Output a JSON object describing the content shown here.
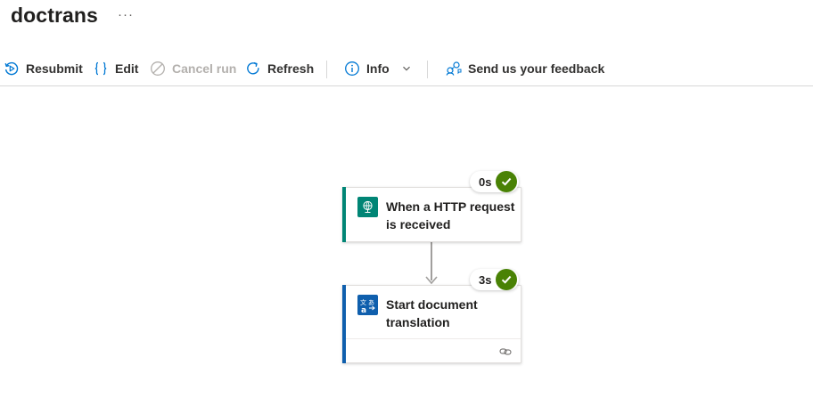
{
  "app": {
    "title": "doctrans",
    "more": "···"
  },
  "toolbar": {
    "resubmit": "Resubmit",
    "edit": "Edit",
    "cancel_run": "Cancel run",
    "refresh": "Refresh",
    "info": "Info",
    "feedback": "Send us your feedback"
  },
  "workflow": {
    "steps": [
      {
        "title": "When a HTTP request is received",
        "duration": "0s",
        "status": "succeeded",
        "accent": "#008575",
        "icon": "http-request-icon"
      },
      {
        "title": "Start document translation",
        "duration": "3s",
        "status": "succeeded",
        "accent": "#0f5fad",
        "icon": "translator-icon"
      }
    ]
  },
  "colors": {
    "accent_blue": "#0078d4",
    "success_green": "#498205",
    "disabled": "#b3b0ad"
  }
}
